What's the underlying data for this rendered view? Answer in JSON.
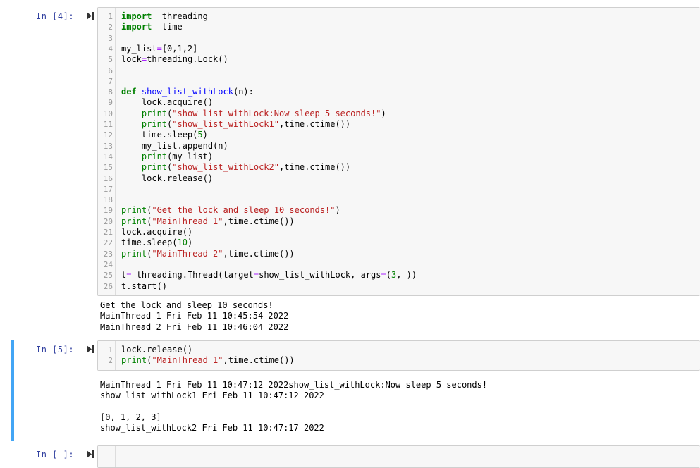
{
  "cells": [
    {
      "prompt": "In  [4]:",
      "lines": [
        {
          "n": "1",
          "segs": [
            [
              "kw",
              "import"
            ],
            [
              "",
              "  threading"
            ]
          ]
        },
        {
          "n": "2",
          "segs": [
            [
              "kw",
              "import"
            ],
            [
              "",
              "  time"
            ]
          ]
        },
        {
          "n": "3",
          "segs": []
        },
        {
          "n": "4",
          "segs": [
            [
              "",
              "my_list"
            ],
            [
              "op",
              "="
            ],
            [
              "",
              "[0,1,2]"
            ]
          ]
        },
        {
          "n": "5",
          "segs": [
            [
              "",
              "lock"
            ],
            [
              "op",
              "="
            ],
            [
              "",
              "threading.Lock()"
            ]
          ]
        },
        {
          "n": "6",
          "segs": []
        },
        {
          "n": "7",
          "segs": []
        },
        {
          "n": "8",
          "segs": [
            [
              "kw",
              "def"
            ],
            [
              "",
              " "
            ],
            [
              "fn",
              "show_list_withLock"
            ],
            [
              "",
              "(n):"
            ]
          ]
        },
        {
          "n": "9",
          "segs": [
            [
              "",
              "    lock.acquire()"
            ]
          ]
        },
        {
          "n": "10",
          "segs": [
            [
              "",
              "    "
            ],
            [
              "bi",
              "print"
            ],
            [
              "",
              "("
            ],
            [
              "str",
              "\"show_list_withLock:Now sleep 5 seconds!\""
            ],
            [
              "",
              ")"
            ]
          ]
        },
        {
          "n": "11",
          "segs": [
            [
              "",
              "    "
            ],
            [
              "bi",
              "print"
            ],
            [
              "",
              "("
            ],
            [
              "str",
              "\"show_list_withLock1\""
            ],
            [
              "",
              ",time.ctime())"
            ]
          ]
        },
        {
          "n": "12",
          "segs": [
            [
              "",
              "    time.sleep("
            ],
            [
              "num",
              "5"
            ],
            [
              "",
              ")"
            ]
          ]
        },
        {
          "n": "13",
          "segs": [
            [
              "",
              "    my_list.append(n)"
            ]
          ]
        },
        {
          "n": "14",
          "segs": [
            [
              "",
              "    "
            ],
            [
              "bi",
              "print"
            ],
            [
              "",
              "(my_list)"
            ]
          ]
        },
        {
          "n": "15",
          "segs": [
            [
              "",
              "    "
            ],
            [
              "bi",
              "print"
            ],
            [
              "",
              "("
            ],
            [
              "str",
              "\"show_list_withLock2\""
            ],
            [
              "",
              ",time.ctime())"
            ]
          ]
        },
        {
          "n": "16",
          "segs": [
            [
              "",
              "    lock.release()"
            ]
          ]
        },
        {
          "n": "17",
          "segs": []
        },
        {
          "n": "18",
          "segs": []
        },
        {
          "n": "19",
          "segs": [
            [
              "bi",
              "print"
            ],
            [
              "",
              "("
            ],
            [
              "str",
              "\"Get the lock and sleep 10 seconds!\""
            ],
            [
              "",
              ")"
            ]
          ]
        },
        {
          "n": "20",
          "segs": [
            [
              "bi",
              "print"
            ],
            [
              "",
              "("
            ],
            [
              "str",
              "\"MainThread 1\""
            ],
            [
              "",
              ",time.ctime())"
            ]
          ]
        },
        {
          "n": "21",
          "segs": [
            [
              "",
              "lock.acquire()"
            ]
          ]
        },
        {
          "n": "22",
          "segs": [
            [
              "",
              "time.sleep("
            ],
            [
              "num",
              "10"
            ],
            [
              "",
              ")"
            ]
          ]
        },
        {
          "n": "23",
          "segs": [
            [
              "bi",
              "print"
            ],
            [
              "",
              "("
            ],
            [
              "str",
              "\"MainThread 2\""
            ],
            [
              "",
              ",time.ctime())"
            ]
          ]
        },
        {
          "n": "24",
          "segs": []
        },
        {
          "n": "25",
          "segs": [
            [
              "",
              "t"
            ],
            [
              "op",
              "="
            ],
            [
              "",
              " threading.Thread(target"
            ],
            [
              "op",
              "="
            ],
            [
              "",
              "show_list_withLock, args"
            ],
            [
              "op",
              "="
            ],
            [
              "",
              "("
            ],
            [
              "num",
              "3"
            ],
            [
              "",
              ", ))"
            ]
          ]
        },
        {
          "n": "26",
          "segs": [
            [
              "",
              "t.start()"
            ]
          ]
        }
      ],
      "output": [
        "Get the lock and sleep 10 seconds!",
        "MainThread 1 Fri Feb 11 10:45:54 2022",
        "MainThread 2 Fri Feb 11 10:46:04 2022"
      ]
    },
    {
      "prompt": "In  [5]:",
      "lines": [
        {
          "n": "1",
          "segs": [
            [
              "",
              "lock.release()"
            ]
          ]
        },
        {
          "n": "2",
          "segs": [
            [
              "bi",
              "print"
            ],
            [
              "",
              "("
            ],
            [
              "str",
              "\"MainThread 1\""
            ],
            [
              "",
              ",time.ctime())"
            ]
          ]
        }
      ],
      "output": [
        "MainThread 1 Fri Feb 11 10:47:12 2022show_list_withLock:Now sleep 5 seconds!",
        "show_list_withLock1 Fri Feb 11 10:47:12 2022",
        "",
        "[0, 1, 2, 3]",
        "show_list_withLock2 Fri Feb 11 10:47:17 2022"
      ]
    },
    {
      "prompt": "In  [ ]:",
      "lines": [],
      "output": []
    }
  ],
  "colors": {
    "accent": "#42a5f5",
    "prompt": "#303f9f",
    "keyword": "#008000",
    "string": "#ba2121"
  },
  "icons": {
    "run": "run-cell-icon"
  }
}
